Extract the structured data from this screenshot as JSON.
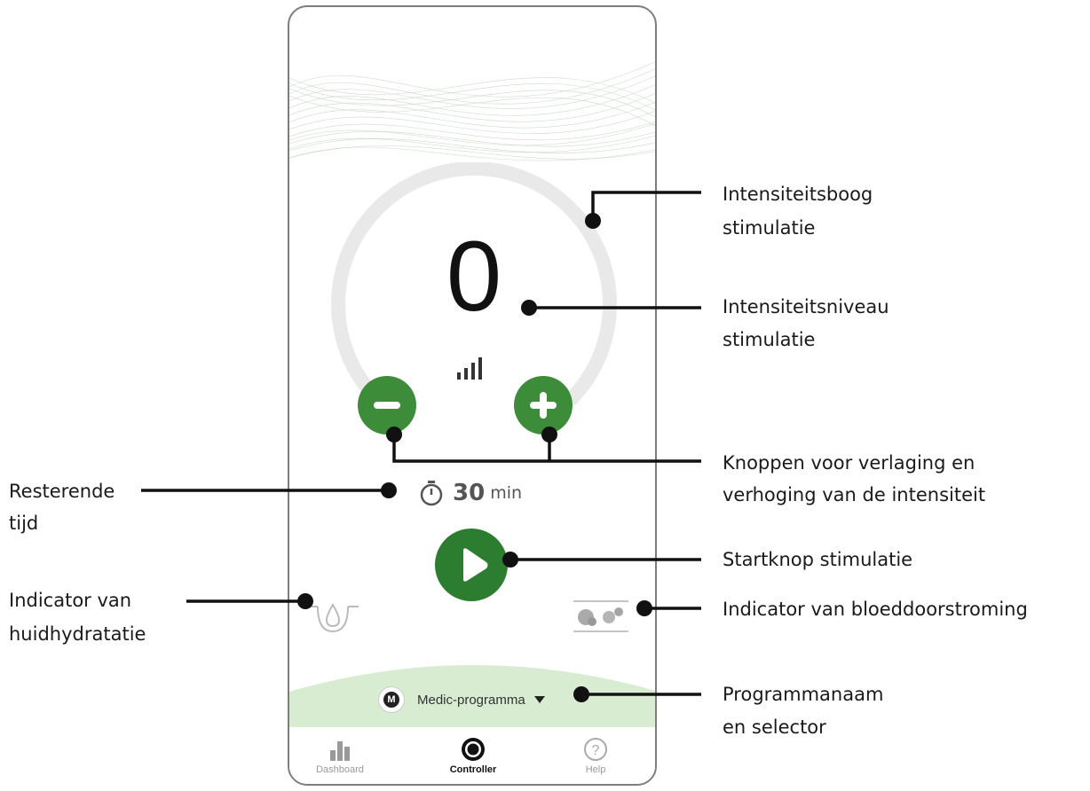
{
  "screen": {
    "intensity_level": "0",
    "intensity_fraction": 0,
    "timer": {
      "value": "30",
      "unit": "min"
    },
    "program": {
      "name": "Medic-programma",
      "logo_letter": "M"
    },
    "nav": [
      {
        "label": "Dashboard",
        "icon": "bar-chart-icon",
        "active": false
      },
      {
        "label": "Controller",
        "icon": "controller-icon",
        "active": true
      },
      {
        "label": "Help",
        "icon": "help-icon",
        "active": false
      }
    ]
  },
  "callouts": {
    "arc_line1": "Intensiteitsboog",
    "arc_line2": "stimulatie",
    "level_line1": "Intensiteitsniveau",
    "level_line2": "stimulatie",
    "buttons_line1": "Knoppen voor verlaging en",
    "buttons_line2": "verhoging van de intensiteit",
    "time_line1": "Resterende",
    "time_line2": "tijd",
    "start_label": "Startknop stimulatie",
    "hydration_line1": "Indicator van",
    "hydration_line2": "huidhydratatie",
    "bloodflow_label": "Indicator van bloeddoorstroming",
    "program_line1": "Programmanaam",
    "program_line2": "en selector"
  },
  "colors": {
    "accent_green": "#3d8c3a",
    "play_green": "#2d7d30",
    "band_green": "#d8ecd2",
    "arc_gray": "#e9e9e9",
    "frame_gray": "#7d7d7d"
  }
}
